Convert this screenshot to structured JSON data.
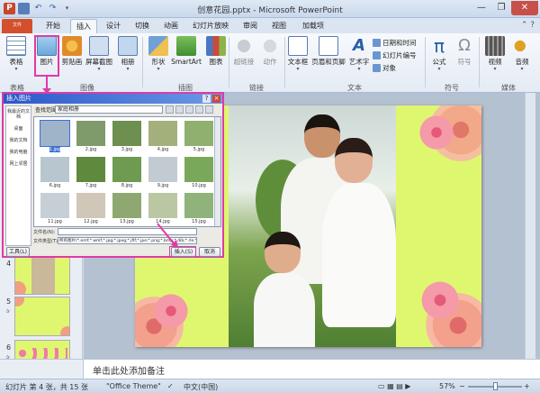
{
  "window": {
    "title": "创意花园.pptx - Microsoft PowerPoint",
    "close": "✕",
    "maximize": "❐",
    "minimize": "—"
  },
  "tabs": [
    {
      "label": "文件"
    },
    {
      "label": "开始"
    },
    {
      "label": "插入"
    },
    {
      "label": "设计"
    },
    {
      "label": "切换"
    },
    {
      "label": "动画"
    },
    {
      "label": "幻灯片放映"
    },
    {
      "label": "审阅"
    },
    {
      "label": "视图"
    },
    {
      "label": "加载项"
    }
  ],
  "ribbon": {
    "table": "表格",
    "picture": "图片",
    "clipart": "剪贴画",
    "screenshot": "屏幕截图",
    "album": "相册",
    "shapes": "形状",
    "smartart": "SmartArt",
    "chart": "图表",
    "hyperlink": "超链接",
    "action": "动作",
    "textbox": "文本框",
    "header_footer": "页眉和页脚",
    "wordart": "艺术字",
    "datetime": "日期和时间",
    "slide_number": "幻灯片编号",
    "object": "对象",
    "equation": "公式",
    "symbol": "符号",
    "video": "视频",
    "audio": "音频",
    "groups": {
      "tables": "表格",
      "images": "图像",
      "illustrations": "插图",
      "links": "链接",
      "text": "文本",
      "symbols": "符号",
      "media": "媒体"
    }
  },
  "dialog": {
    "title": "插入图片",
    "help": "?",
    "close": "×",
    "look_in_label": "查找范围(I):",
    "look_in_value": "家庭相册",
    "places": [
      "我最近的文档",
      "桌面",
      "我的文档",
      "我的电脑",
      "网上邻居"
    ],
    "files": [
      "1.jpg",
      "2.jpg",
      "3.jpg",
      "4.jpg",
      "5.jpg",
      "6.jpg",
      "7.jpg",
      "8.jpg",
      "9.jpg",
      "10.jpg",
      "11.jpg",
      "12.jpg",
      "13.jpg",
      "14.jpg",
      "15.jpg"
    ],
    "filename_label": "文件名(N):",
    "filetype_label": "文件类型(T):",
    "filetype_value": "所有图片(*.emf;*.wmf;*.jpg;*.jpeg;*.jfif;*.jpe;*.png;*.bmp;*.dib;*.rle;*.gif;*.emz;*.wmz;*.pcz;*.tif;*.tiff;*.eps;*.pct;*.pict;*.wpg)",
    "tools_button": "工具(L)",
    "insert_button": "插入(S)",
    "cancel_button": "取消"
  },
  "slides_pane": {
    "items": [
      {
        "num": "4"
      },
      {
        "num": "5"
      },
      {
        "num": "6"
      }
    ]
  },
  "notes_placeholder": "单击此处添加备注",
  "status": {
    "slide": "幻灯片 第 4 张，共 15 张",
    "theme": "\"Office Theme\"",
    "language": "中文(中国)",
    "zoom": "57%"
  }
}
